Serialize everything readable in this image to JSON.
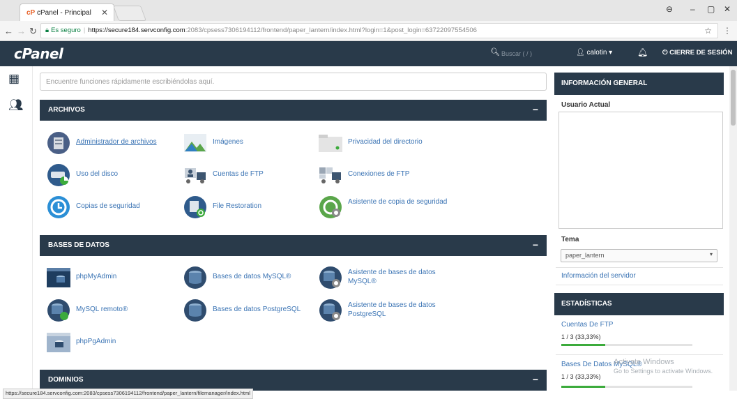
{
  "browser": {
    "tab_title": "cPanel - Principal",
    "tab_favicon": "cP",
    "secure_label": "Es seguro",
    "url_host": "https://secure184.servconfig.com",
    "url_path": ":2083/cpsess7306194112/frontend/paper_lantern/index.html?login=1&post_login=63722097554506",
    "status_url": "https://secure184.servconfig.com:2083/cpsess7306194112/frontend/paper_lantern/filemanager/index.html"
  },
  "header": {
    "logo": "cPanel",
    "search_placeholder": "Buscar ( / )",
    "username": "calotin",
    "logout_label": "CIERRE DE SESIÓN"
  },
  "main": {
    "finder_placeholder": "Encuentre funciones rápidamente escribiéndolas aquí.",
    "sections": {
      "archivos": {
        "title": "ARCHIVOS",
        "items": [
          "Administrador de archivos",
          "Imágenes",
          "Privacidad del directorio",
          "Uso del disco",
          "Cuentas de FTP",
          "Conexiones de FTP",
          "Copias de seguridad",
          "File Restoration",
          "Asistente de copia de seguridad"
        ]
      },
      "bases": {
        "title": "BASES DE DATOS",
        "items": [
          "phpMyAdmin",
          "Bases de datos MySQL®",
          "Asistente de bases de datos MySQL®",
          "MySQL remoto®",
          "Bases de datos PostgreSQL",
          "Asistente de bases de datos PostgreSQL",
          "phpPgAdmin"
        ]
      },
      "dominios": {
        "title": "DOMINIOS"
      }
    }
  },
  "sidebar": {
    "general_title": "INFORMACIÓN GENERAL",
    "current_user_label": "Usuario Actual",
    "theme_label": "Tema",
    "theme_value": "paper_lantern",
    "server_info_link": "Información del servidor",
    "stats_title": "ESTADÍSTICAS",
    "stats": [
      {
        "label": "Cuentas De FTP",
        "value": "1 / 3   (33,33%)",
        "fraction": 0.3333
      },
      {
        "label": "Bases De Datos MySQL®",
        "value": "1 / 3   (33,33%)",
        "fraction": 0.3333
      }
    ]
  },
  "overlay": {
    "watermark_title": "Activate Windows",
    "watermark_sub": "Go to Settings to activate Windows."
  },
  "colors": {
    "header_bg": "#293a4a",
    "link": "#3b74b4",
    "progress": "#3cab3c"
  }
}
